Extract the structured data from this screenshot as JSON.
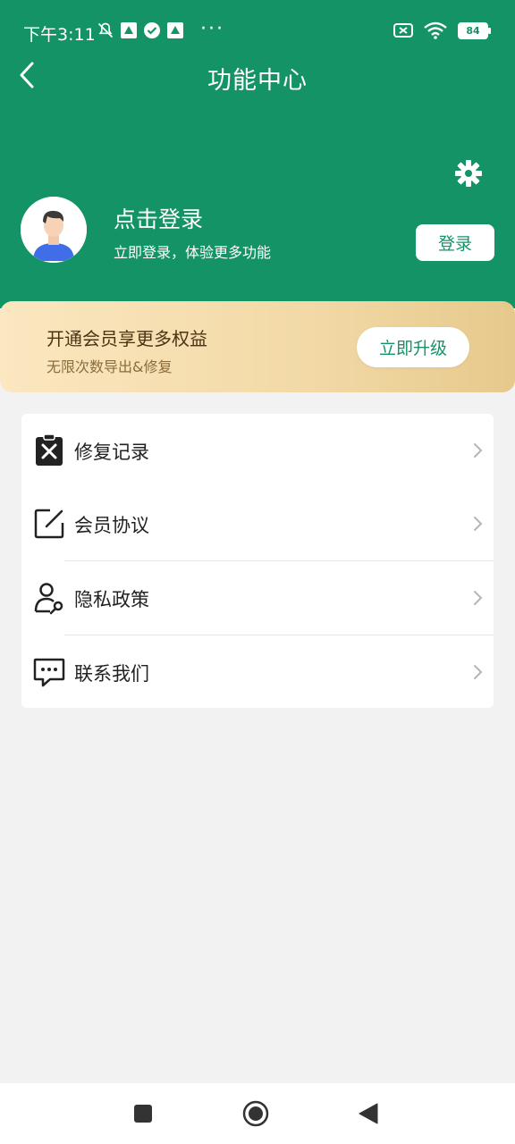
{
  "status_bar": {
    "time": "下午3:11",
    "dots": "···",
    "battery": "84"
  },
  "header": {
    "title": "功能中心",
    "back_icon": "chevron-left-icon",
    "settings_icon": "gear-icon"
  },
  "user": {
    "login_title": "点击登录",
    "login_subtitle": "立即登录，体验更多功能",
    "login_button": "登录"
  },
  "vip": {
    "title": "开通会员享更多权益",
    "subtitle": "无限次数导出&修复",
    "button": "立即升级"
  },
  "menu": {
    "items": [
      {
        "label": "修复记录",
        "icon": "repair-record-icon"
      },
      {
        "label": "会员协议",
        "icon": "edit-document-icon"
      },
      {
        "label": "隐私政策",
        "icon": "user-privacy-icon"
      },
      {
        "label": "联系我们",
        "icon": "chat-bubble-icon"
      }
    ]
  },
  "colors": {
    "primary": "#149466",
    "background": "#f2f2f2",
    "vip_gradient_start": "#fbe7c0",
    "vip_gradient_end": "#e6c98c"
  }
}
